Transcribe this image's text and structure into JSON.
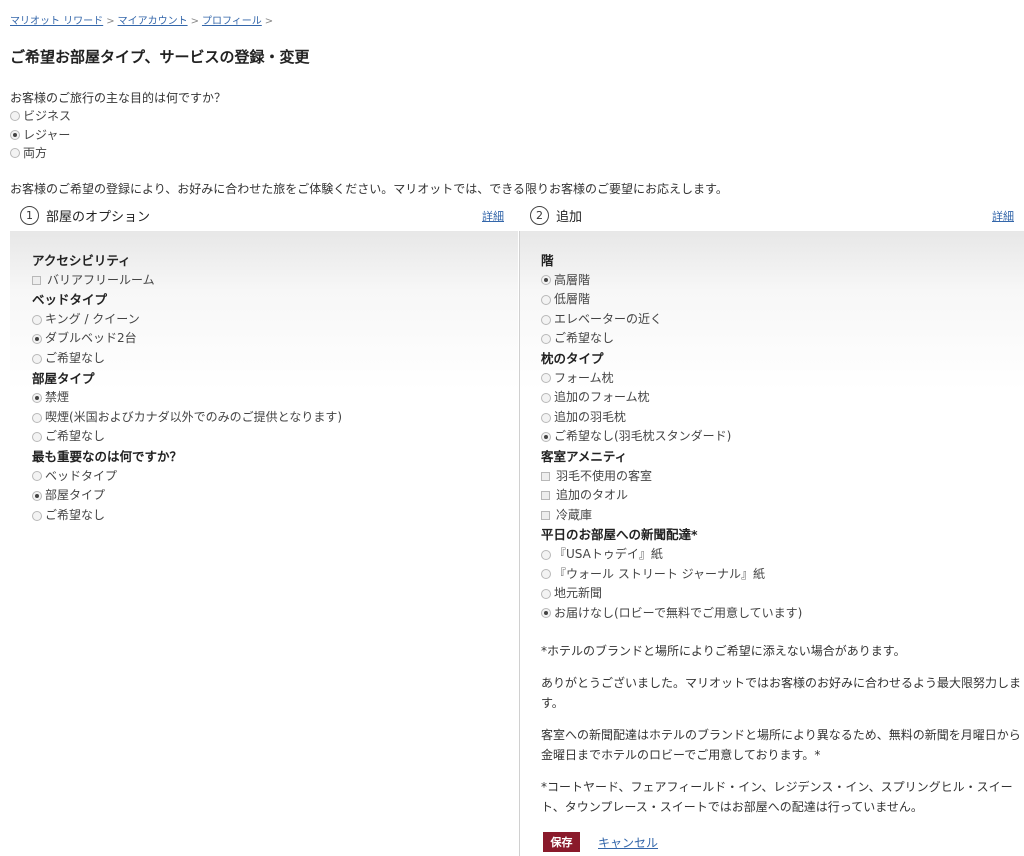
{
  "breadcrumb": [
    "マリオット リワード",
    "マイアカウント",
    "プロフィール"
  ],
  "page_title": "ご希望お部屋タイプ、サービスの登録・変更",
  "purpose": {
    "question": "お客様のご旅行の主な目的は何ですか？",
    "options": [
      {
        "label": "ビジネス",
        "checked": false
      },
      {
        "label": "レジャー",
        "checked": true
      },
      {
        "label": "両方",
        "checked": false
      }
    ]
  },
  "intro": "お客様のご希望の登録により、お好みに合わせた旅をご体験ください。マリオットでは、できる限りお客様のご要望にお応えします。",
  "sections": [
    {
      "number": "1",
      "title": "部屋のオプション",
      "detail_link": "詳細"
    },
    {
      "number": "2",
      "title": "追加",
      "detail_link": "詳細"
    }
  ],
  "left_groups": [
    {
      "title": "アクセシビリティ",
      "type": "checkbox",
      "options": [
        {
          "label": "バリアフリールーム",
          "checked": false
        }
      ]
    },
    {
      "title": "ベッドタイプ",
      "type": "radio",
      "options": [
        {
          "label": "キング / クイーン",
          "checked": false
        },
        {
          "label": "ダブルベッド2台",
          "checked": true
        },
        {
          "label": "ご希望なし",
          "checked": false
        }
      ]
    },
    {
      "title": "部屋タイプ",
      "type": "radio",
      "options": [
        {
          "label": "禁煙",
          "checked": true
        },
        {
          "label": "喫煙(米国およびカナダ以外でのみのご提供となります)",
          "checked": false
        },
        {
          "label": "ご希望なし",
          "checked": false
        }
      ]
    },
    {
      "title": "最も重要なのは何ですか？",
      "type": "radio",
      "options": [
        {
          "label": "ベッドタイプ",
          "checked": false
        },
        {
          "label": "部屋タイプ",
          "checked": true
        },
        {
          "label": "ご希望なし",
          "checked": false
        }
      ]
    }
  ],
  "right_groups": [
    {
      "title": "階",
      "type": "radio",
      "options": [
        {
          "label": "高層階",
          "checked": true
        },
        {
          "label": "低層階",
          "checked": false
        },
        {
          "label": "エレベーターの近く",
          "checked": false
        },
        {
          "label": "ご希望なし",
          "checked": false
        }
      ]
    },
    {
      "title": "枕のタイプ",
      "type": "radio",
      "options": [
        {
          "label": "フォーム枕",
          "checked": false
        },
        {
          "label": "追加のフォーム枕",
          "checked": false
        },
        {
          "label": "追加の羽毛枕",
          "checked": false
        },
        {
          "label": "ご希望なし(羽毛枕スタンダード)",
          "checked": true
        }
      ]
    },
    {
      "title": "客室アメニティ",
      "type": "checkbox",
      "options": [
        {
          "label": "羽毛不使用の客室",
          "checked": false
        },
        {
          "label": "追加のタオル",
          "checked": false
        },
        {
          "label": "冷蔵庫",
          "checked": false
        }
      ]
    },
    {
      "title": "平日のお部屋への新聞配達*",
      "type": "radio",
      "options": [
        {
          "label": "『USAトゥデイ』紙",
          "checked": false
        },
        {
          "label": "『ウォール ストリート ジャーナル』紙",
          "checked": false
        },
        {
          "label": "地元新聞",
          "checked": false
        },
        {
          "label": "お届けなし(ロビーで無料でご用意しています)",
          "checked": true
        }
      ]
    }
  ],
  "notes": [
    "*ホテルのブランドと場所によりご希望に添えない場合があります。",
    "ありがとうございました。マリオットではお客様のお好みに合わせるよう最大限努力します。",
    "客室への新聞配達はホテルのブランドと場所により異なるため、無料の新聞を月曜日から金曜日までホテルのロビーでご用意しております。*",
    "*コートヤード、フェアフィールド・イン、レジデンス・イン、スプリングヒル・スイート、タウンプレース・スイートではお部屋への配達は行っていません。"
  ],
  "actions": {
    "save": "保存",
    "cancel": "キャンセル"
  }
}
